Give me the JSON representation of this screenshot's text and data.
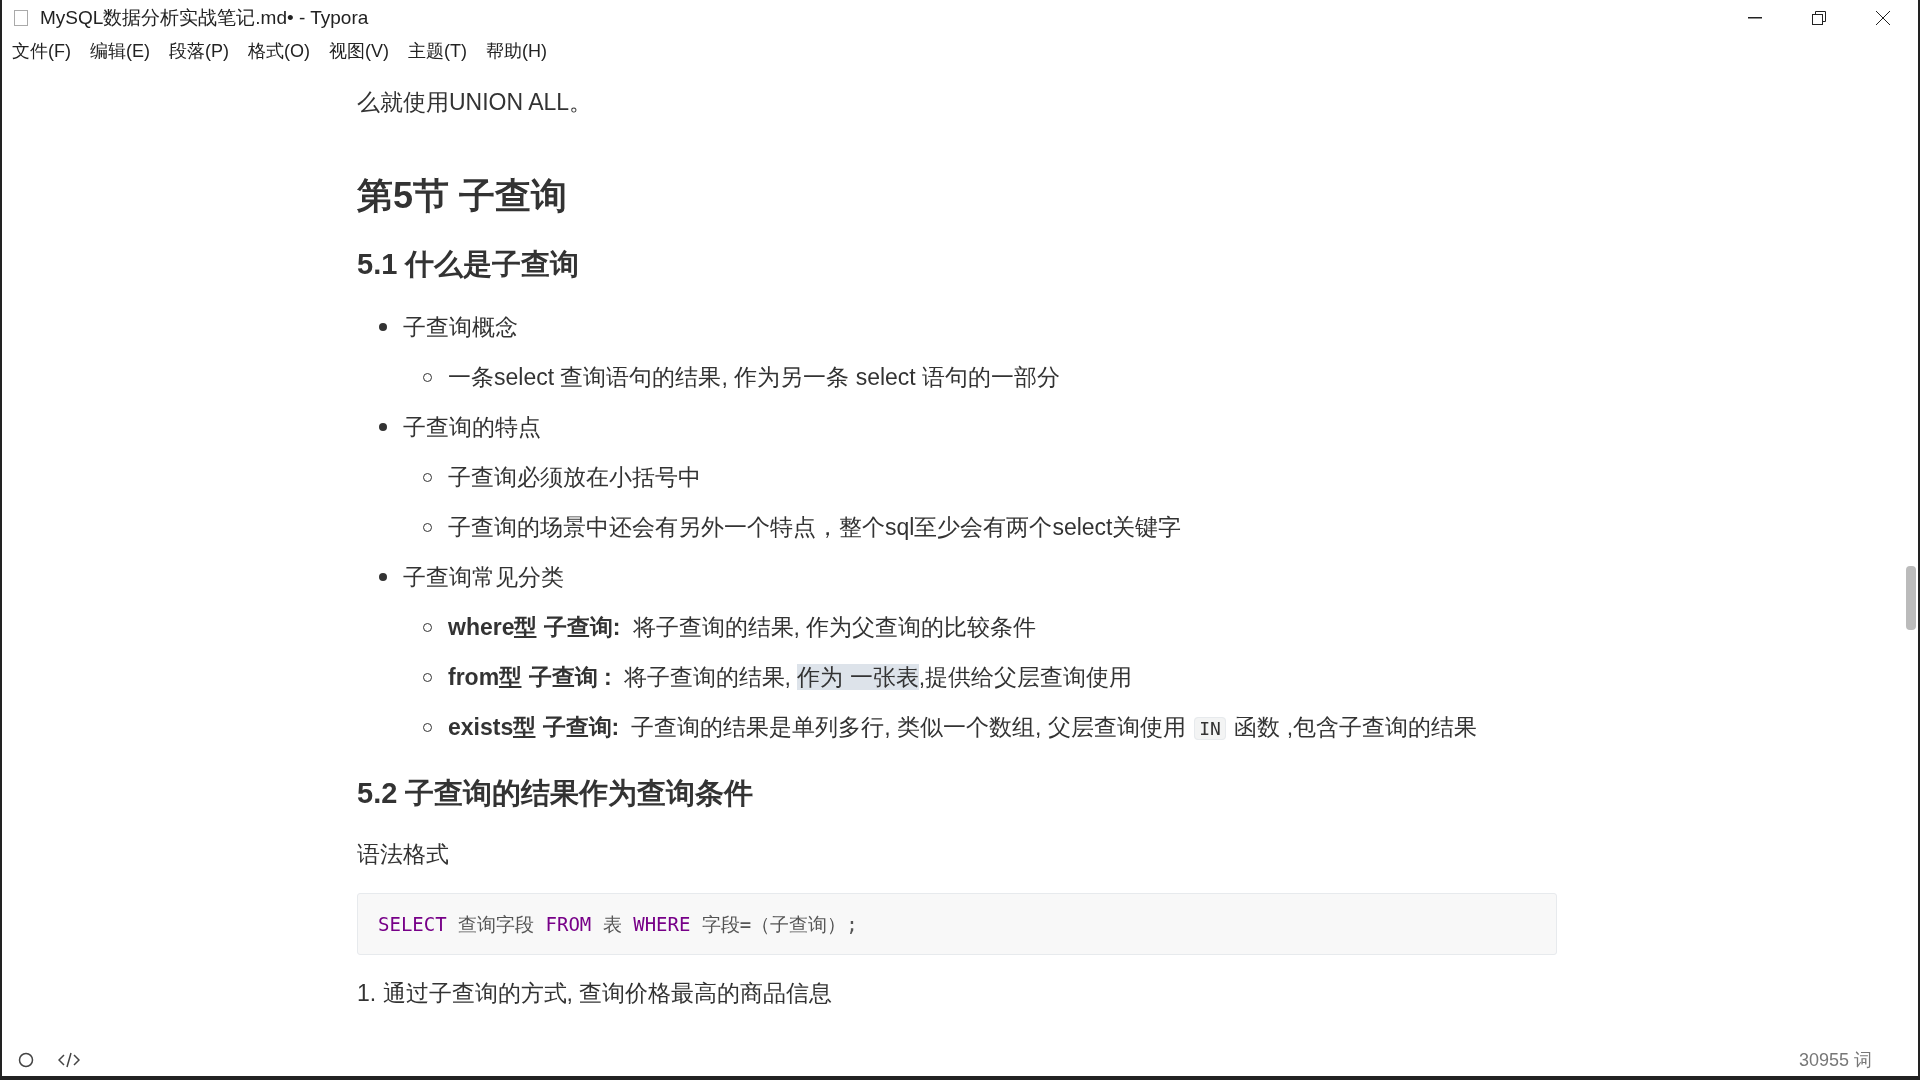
{
  "window": {
    "title": "MySQL数据分析实战笔记.md• - Typora"
  },
  "menu": [
    "文件(F)",
    "编辑(E)",
    "段落(P)",
    "格式(O)",
    "视图(V)",
    "主题(T)",
    "帮助(H)"
  ],
  "document": [
    {
      "kind": "paragraph",
      "text": "么就使用UNION ALL。"
    },
    {
      "kind": "h1",
      "text": "第5节 子查询"
    },
    {
      "kind": "h2",
      "text": "5.1 什么是子查询"
    },
    {
      "kind": "bullets",
      "items": [
        {
          "text": "子查询概念",
          "children": [
            {
              "parts": [
                {
                  "kind": "plain",
                  "text": "一条select 查询语句的结果, 作为另一条 select 语句的一部分"
                }
              ]
            }
          ]
        },
        {
          "text": "子查询的特点",
          "children": [
            {
              "parts": [
                {
                  "kind": "plain",
                  "text": "子查询必须放在小括号中"
                }
              ]
            },
            {
              "parts": [
                {
                  "kind": "plain",
                  "text": "子查询的场景中还会有另外一个特点，整个sql至少会有两个select关键字"
                }
              ]
            }
          ]
        },
        {
          "text": "子查询常见分类",
          "children": [
            {
              "term": "where型 子查询:",
              "parts": [
                {
                  "kind": "plain",
                  "text": "将子查询的结果, 作为父查询的比较条件"
                }
              ]
            },
            {
              "term": "from型 子查询 :",
              "parts": [
                {
                  "kind": "plain",
                  "text": "将子查询的结果, "
                },
                {
                  "kind": "selected",
                  "text": "作为 一张表"
                },
                {
                  "kind": "plain",
                  "text": ",提供给父层查询使用"
                }
              ]
            },
            {
              "term": "exists型 子查询:",
              "parts": [
                {
                  "kind": "plain",
                  "text": "子查询的结果是单列多行, 类似一个数组, 父层查询使用 "
                },
                {
                  "kind": "code",
                  "text": "IN"
                },
                {
                  "kind": "plain",
                  "text": " 函数 ,包含子查询的结果"
                }
              ]
            }
          ]
        }
      ]
    },
    {
      "kind": "h2",
      "text": "5.2 子查询的结果作为查询条件"
    },
    {
      "kind": "paragraph",
      "text": "语法格式"
    },
    {
      "kind": "code",
      "tokens": [
        {
          "kind": "keyword",
          "text": "SELECT"
        },
        {
          "kind": "plain",
          "text": " 查询字段 "
        },
        {
          "kind": "keyword",
          "text": "FROM"
        },
        {
          "kind": "plain",
          "text": " 表 "
        },
        {
          "kind": "keyword",
          "text": "WHERE"
        },
        {
          "kind": "plain",
          "text": " 字段=（子查询）;"
        }
      ]
    },
    {
      "kind": "paragraph",
      "text": "1. 通过子查询的方式, 查询价格最高的商品信息"
    }
  ],
  "status_bar": {
    "word_count": "30955 词"
  }
}
